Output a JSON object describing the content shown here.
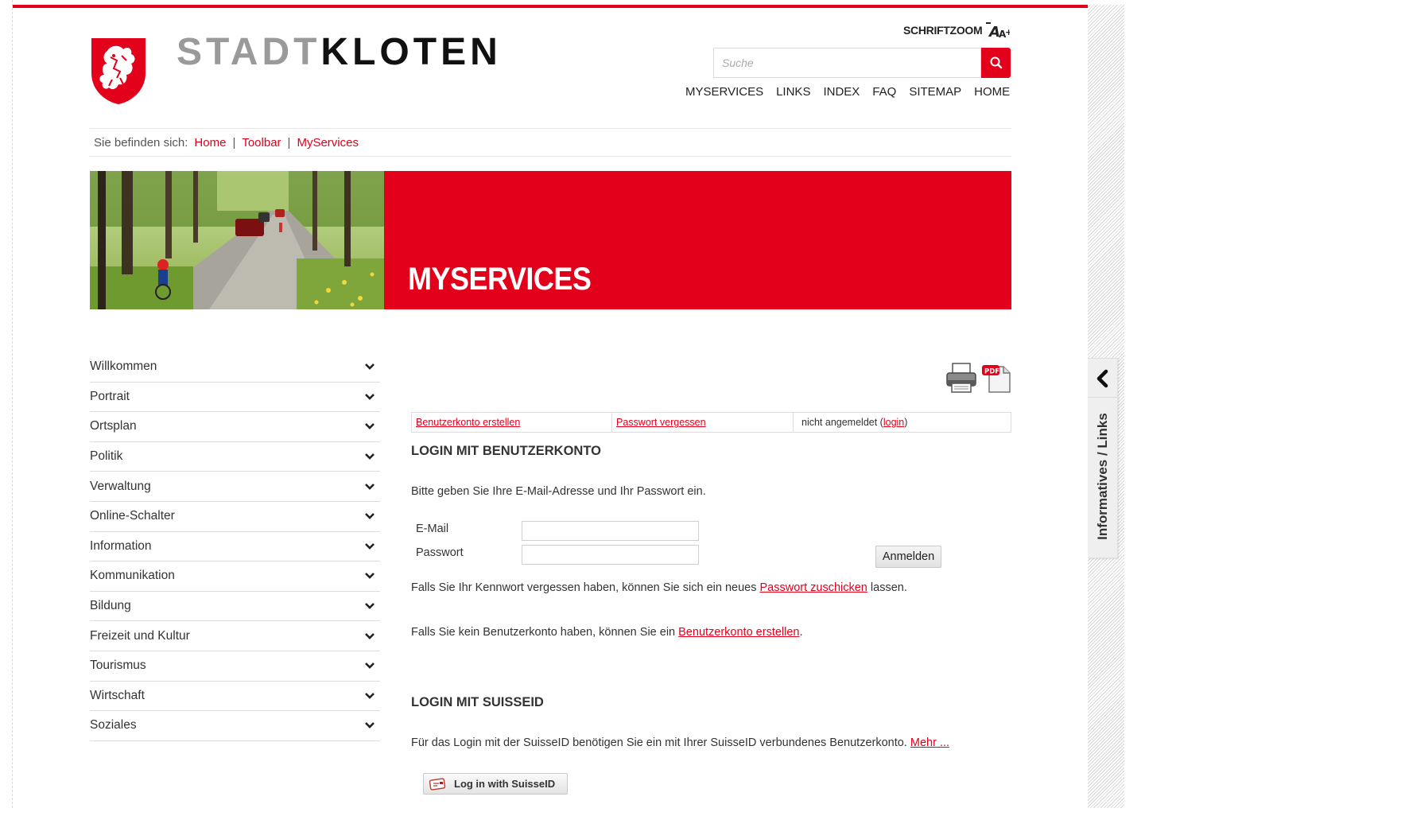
{
  "brand": {
    "light": "STADT",
    "dark": "KLOTEN"
  },
  "fontzoom": {
    "label": "SCHRIFTZOOM",
    "icon": "font-size-icon"
  },
  "search": {
    "placeholder": "Suche",
    "value": "",
    "icon": "search-icon"
  },
  "topnav": [
    "MYSERVICES",
    "LINKS",
    "INDEX",
    "FAQ",
    "SITEMAP",
    "HOME"
  ],
  "breadcrumb": {
    "prefix": "Sie befinden sich:",
    "items": [
      "Home",
      "Toolbar",
      "MyServices"
    ],
    "separator": "|"
  },
  "banner": {
    "title": "MYSERVICES"
  },
  "leftnav": [
    "Willkommen",
    "Portrait",
    "Ortsplan",
    "Politik",
    "Verwaltung",
    "Online-Schalter",
    "Information",
    "Kommunikation",
    "Bildung",
    "Freizeit und Kultur",
    "Tourismus",
    "Wirtschaft",
    "Soziales"
  ],
  "account_bar": {
    "create": "Benutzerkonto erstellen",
    "forgot": "Passwort vergessen",
    "status_prefix": "nicht angemeldet (",
    "status_link": "login",
    "status_suffix": ")"
  },
  "login_section": {
    "heading": "LOGIN MIT BENUTZERKONTO",
    "intro": "Bitte geben Sie Ihre E-Mail-Adresse und Ihr Passwort ein.",
    "email_label": "E-Mail",
    "email_value": "",
    "password_label": "Passwort",
    "password_value": "",
    "submit": "Anmelden",
    "forgot_text_before": "Falls Sie Ihr Kennwort vergessen haben, können Sie sich ein neues ",
    "forgot_link": "Passwort zuschicken",
    "forgot_text_after": " lassen.",
    "create_text_before": "Falls Sie kein Benutzerkonto haben, können Sie ein ",
    "create_link": "Benutzerkonto erstellen",
    "create_text_after": "."
  },
  "suisse_section": {
    "heading": "LOGIN MIT SUISSEID",
    "text": "Für das Login mit der SuisseID benötigen Sie ein mit Ihrer SuisseID verbundenes Benutzerkonto. ",
    "more_link": "Mehr ...",
    "button": "Log in with SuisseID"
  },
  "side_tab": {
    "label": "Informatives / Links"
  },
  "colors": {
    "accent": "#e2001a",
    "text": "#333333",
    "border": "#dcdcdc"
  }
}
